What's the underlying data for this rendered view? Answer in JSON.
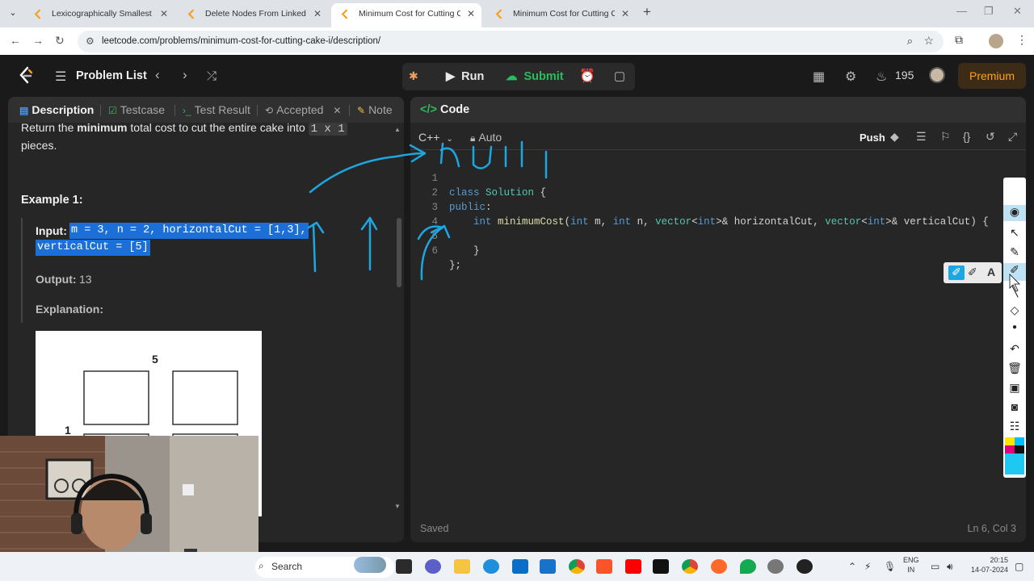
{
  "browser": {
    "tabs": [
      {
        "title": "Lexicographically Smallest Strin",
        "favicon_color": "#f89f1b"
      },
      {
        "title": "Delete Nodes From Linked List",
        "favicon_color": "#f89f1b"
      },
      {
        "title": "Minimum Cost for Cutting Cake",
        "favicon_color": "#f89f1b"
      },
      {
        "title": "Minimum Cost for Cutting Cake",
        "favicon_color": "#f89f1b"
      }
    ],
    "url": "leetcode.com/problems/minimum-cost-for-cutting-cake-i/description/"
  },
  "header": {
    "problem_list": "Problem List",
    "run": "Run",
    "submit": "Submit",
    "streak": "195",
    "premium": "Premium"
  },
  "left_pane": {
    "tabs": [
      "Description",
      "Testcase",
      "Test Result",
      "Accepted",
      "Note"
    ],
    "desc_line1_prefix": "Return the ",
    "desc_line1_bold": "minimum",
    "desc_line1_suffix": " total cost to cut the entire cake into ",
    "desc_inline_code": "1 x 1",
    "desc_line2": "pieces.",
    "example_title": "Example 1:",
    "input_label": "Input:",
    "input_line1": "m = 3, n = 2, horizontalCut = [1,3],",
    "input_line2": "verticalCut = [5]",
    "output_label": "Output:",
    "output_value": "13",
    "explanation_label": "Explanation:",
    "figure_label_top": "5",
    "figure_label_left": "1"
  },
  "right_pane": {
    "title": "Code",
    "language": "C++",
    "mode": "Auto",
    "push": "Push",
    "code_lines": [
      {
        "n": "1",
        "text": "class Solution {"
      },
      {
        "n": "2",
        "text": "public:"
      },
      {
        "n": "3",
        "text": "    int minimumCost(int m, int n, vector<int>& horizontalCut, vector<int>& verticalCut) {"
      },
      {
        "n": "4",
        "text": ""
      },
      {
        "n": "5",
        "text": "    }"
      },
      {
        "n": "6",
        "text": "};"
      }
    ],
    "status_saved": "Saved",
    "cursor_pos": "Ln 6, Col 3"
  },
  "taskbar": {
    "search": "Search",
    "lang_line1": "ENG",
    "lang_line2": "IN",
    "time": "20:15",
    "date": "14-07-2024"
  },
  "colors": {
    "accent_green": "#2cbb5d",
    "premium_orange": "#ffa116",
    "selection_blue": "#1b6fd6",
    "annotation_stroke": "#1ea6e0"
  }
}
